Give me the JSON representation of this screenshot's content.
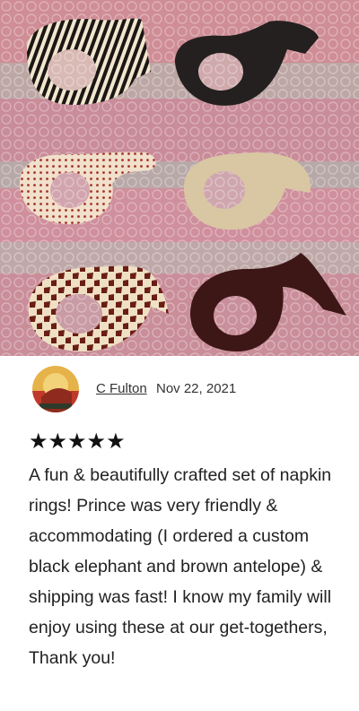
{
  "review": {
    "author": "C Fulton",
    "date": "Nov 22, 2021",
    "rating": 5,
    "stars": "★★★★★",
    "text": "A fun & beautifully crafted set of napkin rings! Prince was very friendly & accommodating (I ordered a custom black elephant and brown antelope) & shipping was fast! I know my family will enjoy using these at our get-togethers, Thank you!"
  }
}
